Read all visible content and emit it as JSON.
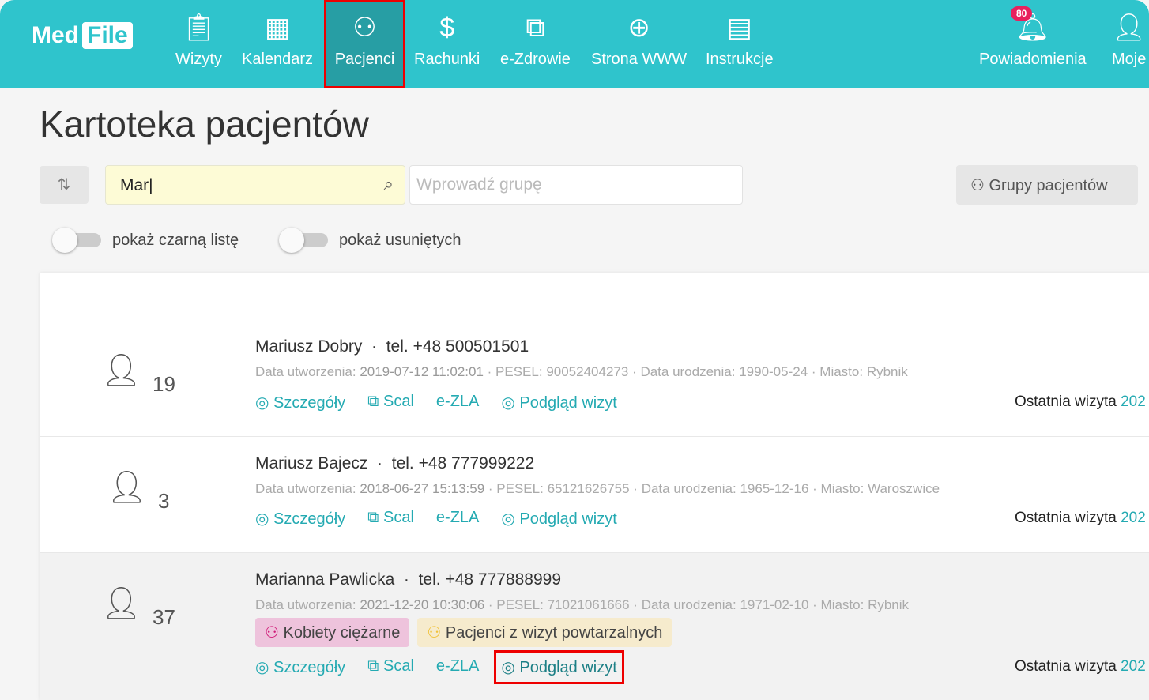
{
  "brand": {
    "part1": "Med",
    "part2": "File"
  },
  "nav": [
    {
      "label": "Wizyty",
      "icon": "clipboard-list-icon"
    },
    {
      "label": "Kalendarz",
      "icon": "calendar-icon"
    },
    {
      "label": "Pacjenci",
      "icon": "users-icon",
      "active": true
    },
    {
      "label": "Rachunki",
      "icon": "dollar-icon"
    },
    {
      "label": "e-Zdrowie",
      "icon": "medical-document-icon"
    },
    {
      "label": "Strona WWW",
      "icon": "globe-icon"
    },
    {
      "label": "Instrukcje",
      "icon": "book-icon"
    },
    {
      "label": "Powiadomienia",
      "icon": "bell-icon",
      "badge": "80"
    },
    {
      "label": "Moje",
      "icon": "user-icon"
    }
  ],
  "page_title": "Kartoteka pacjentów",
  "search": {
    "value": "Mar",
    "group_placeholder": "Wprowadź grupę"
  },
  "groups_button": "Grupy pacjentów",
  "toggles": {
    "blacklist": "pokaż czarną listę",
    "deleted": "pokaż usuniętych"
  },
  "actions": {
    "details": "Szczegóły",
    "merge": "Scal",
    "ezla": "e-ZLA",
    "visits": "Podgląd wizyt",
    "last_visit": "Ostatnia wizyta",
    "last_visit_value": "202"
  },
  "labels": {
    "created": "Data utworzenia:",
    "pesel": "PESEL:",
    "birth": "Data urodzenia:",
    "city": "Miasto:"
  },
  "patients": [
    {
      "count": "19",
      "name": "Mariusz Dobry",
      "phone": "tel. +48 500501501",
      "created": "2019-07-12 11:02:01",
      "pesel": "90052404273",
      "birth": "1990-05-24",
      "city": "Rybnik"
    },
    {
      "count": "3",
      "name": "Mariusz Bajecz",
      "phone": "tel. +48 777999222",
      "created": "2018-06-27 15:13:59",
      "pesel": "65121626755",
      "birth": "1965-12-16",
      "city": "Waroszwice"
    },
    {
      "count": "37",
      "name": "Marianna Pawlicka",
      "phone": "tel. +48 777888999",
      "created": "2021-12-20 10:30:06",
      "pesel": "71021061666",
      "birth": "1971-02-10",
      "city": "Rybnik",
      "tags": [
        {
          "label": "Kobiety ciężarne",
          "color": "#eec3dc",
          "icon_color": "#d01a78"
        },
        {
          "label": "Pacjenci z wizyt powtarzalnych",
          "color": "#f6ebcd",
          "icon_color": "#f0c23a"
        }
      ]
    }
  ]
}
